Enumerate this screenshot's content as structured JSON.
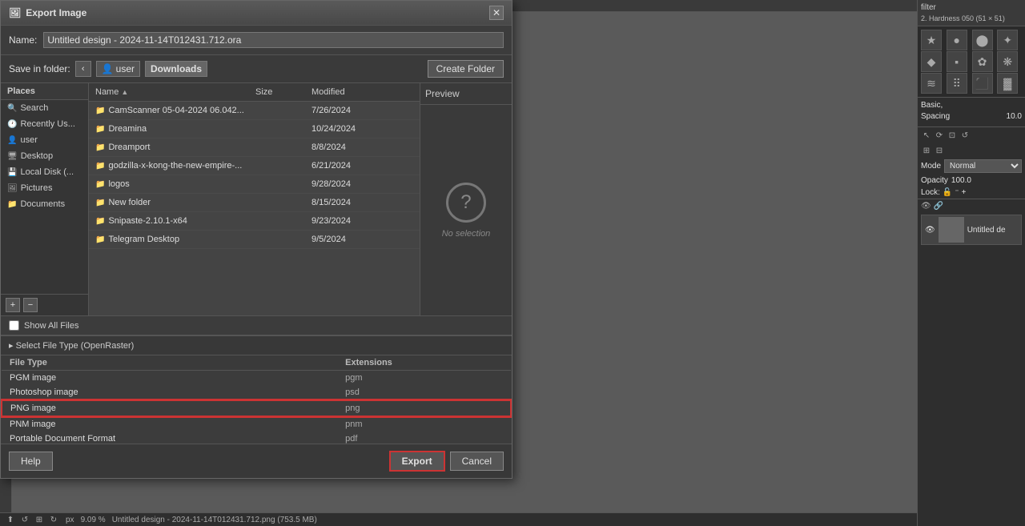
{
  "app": {
    "title": "Export Image",
    "close_icon": "✕"
  },
  "dialog": {
    "title": "Export Image",
    "title_icon": "🖼",
    "name_label": "Name:",
    "name_value": "Untitled design - 2024-11-14T012431.712.ora",
    "save_in_label": "Save in folder:",
    "nav_back": "‹",
    "breadcrumb": [
      {
        "label": "user",
        "icon": "👤"
      },
      {
        "label": "Downloads",
        "icon": ""
      }
    ],
    "create_folder_label": "Create Folder",
    "places": {
      "header": "Places",
      "items": [
        {
          "label": "Search",
          "icon": "🔍",
          "active": false
        },
        {
          "label": "Recently Us...",
          "icon": "🕐",
          "active": false
        },
        {
          "label": "user",
          "icon": "👤",
          "active": false
        },
        {
          "label": "Desktop",
          "icon": "🖥",
          "active": false
        },
        {
          "label": "Local Disk (...",
          "icon": "💾",
          "active": false
        },
        {
          "label": "Pictures",
          "icon": "🖼",
          "active": false
        },
        {
          "label": "Documents",
          "icon": "📁",
          "active": false
        }
      ],
      "add_btn": "+",
      "remove_btn": "−"
    },
    "file_list": {
      "columns": [
        {
          "label": "Name",
          "sort_arrow": "▲"
        },
        {
          "label": "Size"
        },
        {
          "label": "Modified"
        }
      ],
      "files": [
        {
          "name": "CamScanner 05-04-2024 06.042...",
          "icon": "📁",
          "size": "",
          "modified": "7/26/2024"
        },
        {
          "name": "Dreamina",
          "icon": "📁",
          "size": "",
          "modified": "10/24/2024"
        },
        {
          "name": "Dreamport",
          "icon": "📁",
          "size": "",
          "modified": "8/8/2024"
        },
        {
          "name": "godzilla-x-kong-the-new-empire-...",
          "icon": "📁",
          "size": "",
          "modified": "6/21/2024"
        },
        {
          "name": "logos",
          "icon": "📁",
          "size": "",
          "modified": "9/28/2024"
        },
        {
          "name": "New folder",
          "icon": "📁",
          "size": "",
          "modified": "8/15/2024"
        },
        {
          "name": "Snipaste-2.10.1-x64",
          "icon": "📁",
          "size": "",
          "modified": "9/23/2024"
        },
        {
          "name": "Telegram Desktop",
          "icon": "📁",
          "size": "",
          "modified": "9/5/2024"
        }
      ]
    },
    "preview": {
      "header": "Preview",
      "no_selection": "No selection",
      "icon": "?"
    },
    "show_all_files_label": "Show All Files",
    "select_file_type_label": "▸ Select File Type (OpenRaster)",
    "file_types": {
      "col_type": "File Type",
      "col_ext": "Extensions",
      "rows": [
        {
          "type": "PGM image",
          "ext": "pgm",
          "selected": false
        },
        {
          "type": "Photoshop image",
          "ext": "psd",
          "selected": false
        },
        {
          "type": "PNG image",
          "ext": "png",
          "selected": true
        },
        {
          "type": "PNM image",
          "ext": "pnm",
          "selected": false
        },
        {
          "type": "Portable Document Format",
          "ext": "pdf",
          "selected": false
        }
      ]
    },
    "buttons": {
      "help": "Help",
      "export": "Export",
      "cancel": "Cancel"
    }
  },
  "right_panel": {
    "filter_label": "filter",
    "preset_label": "2. Hardness 050 (51 × 51)",
    "brush_label": "Basic,",
    "spacing_label": "Spacing",
    "spacing_value": "10.0",
    "mode_label": "Mode",
    "mode_value": "Normal",
    "opacity_label": "Opacity",
    "opacity_value": "100.0",
    "lock_label": "Lock:",
    "layer_name": "Untitled de"
  },
  "status_bar": {
    "unit": "px",
    "zoom": "9.09 %",
    "filename": "Untitled design - 2024-11-14T012431.712.png (753.5 MB)"
  }
}
